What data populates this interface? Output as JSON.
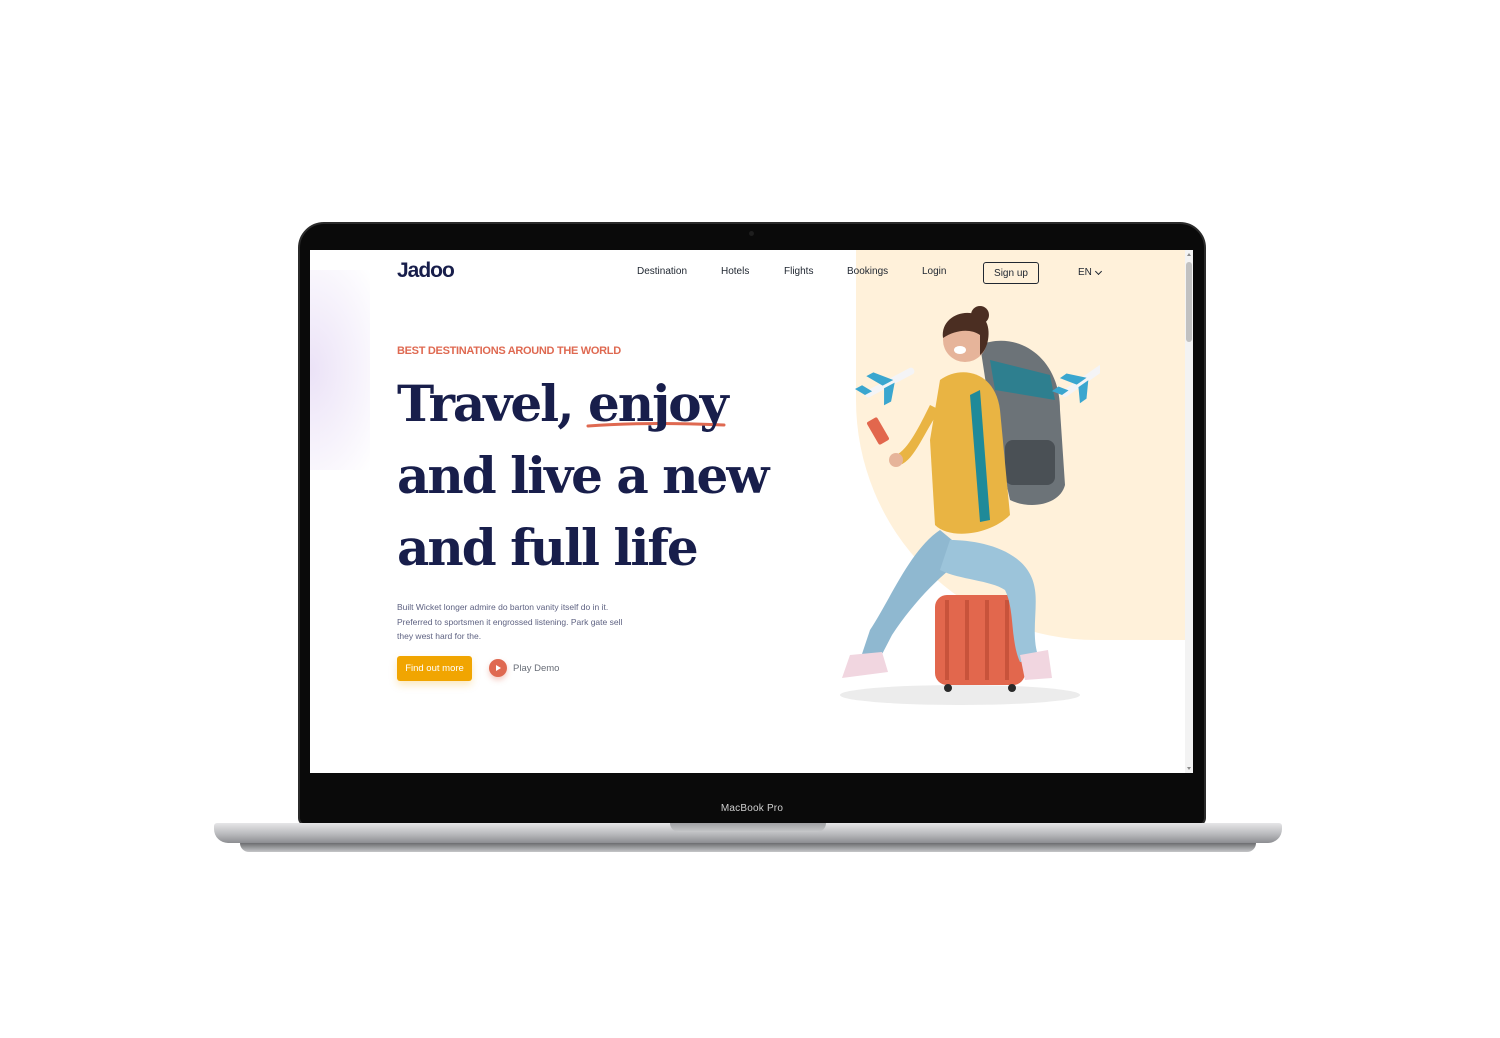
{
  "device": {
    "label": "MacBook Pro"
  },
  "site": {
    "logo": "Jadoo",
    "nav": {
      "items": [
        {
          "label": "Destination"
        },
        {
          "label": "Hotels"
        },
        {
          "label": "Flights"
        },
        {
          "label": "Bookings"
        },
        {
          "label": "Login"
        }
      ],
      "signup_label": "Sign up",
      "language": "EN"
    },
    "hero": {
      "eyebrow": "BEST DESTINATIONS AROUND THE WORLD",
      "headline": {
        "line1_prefix": "Travel, ",
        "line1_highlight": "enjoy",
        "line2": "and live a new",
        "line3": "and full life"
      },
      "description": "Built Wicket longer admire do barton vanity itself do in it. Preferred to sportsmen it engrossed listening. Park gate sell they west hard for the.",
      "cta_label": "Find out more",
      "demo_label": "Play Demo"
    }
  },
  "colors": {
    "primary_text": "#181e4b",
    "accent_orange": "#df6951",
    "accent_yellow": "#f1a501",
    "blob": "#fff1da"
  },
  "icons": [
    "play-icon",
    "chevron-down-icon",
    "airplane-icon"
  ]
}
